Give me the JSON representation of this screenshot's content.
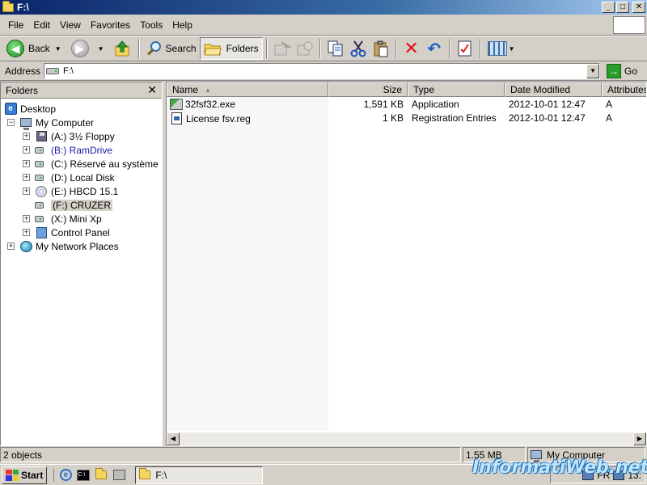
{
  "window": {
    "title": "F:\\",
    "buttons": {
      "minimize": "_",
      "maximize": "□",
      "close": "✕"
    }
  },
  "menu": [
    "File",
    "Edit",
    "View",
    "Favorites",
    "Tools",
    "Help"
  ],
  "toolbar": {
    "back_label": "Back",
    "search_label": "Search",
    "folders_label": "Folders"
  },
  "address": {
    "label": "Address",
    "value": "F:\\",
    "go_label": "Go"
  },
  "folders_pane": {
    "title": "Folders",
    "close": "✕",
    "tree": [
      {
        "label": "Desktop",
        "icon": "desktop-icon"
      },
      {
        "label": "My Computer",
        "icon": "my-computer-icon",
        "expander": "−"
      },
      {
        "label": "(A:) 3½ Floppy",
        "icon": "floppy-drive-icon",
        "expander": "+"
      },
      {
        "label": "(B:) RamDrive",
        "icon": "hard-drive-icon",
        "expander": "+"
      },
      {
        "label": "(C:) Réservé au système",
        "icon": "hard-drive-icon",
        "expander": "+"
      },
      {
        "label": "(D:) Local Disk",
        "icon": "hard-drive-icon",
        "expander": "+"
      },
      {
        "label": "(E:) HBCD 15.1",
        "icon": "cd-drive-icon",
        "expander": "+"
      },
      {
        "label": "(F:) CRUZER",
        "icon": "removable-drive-icon"
      },
      {
        "label": "(X:) Mini Xp",
        "icon": "hard-drive-icon",
        "expander": "+"
      },
      {
        "label": "Control Panel",
        "icon": "control-panel-icon",
        "expander": "+"
      },
      {
        "label": "My Network Places",
        "icon": "network-places-icon",
        "expander": "+"
      }
    ]
  },
  "file_list": {
    "columns": [
      "Name",
      "Size",
      "Type",
      "Date Modified",
      "Attributes"
    ],
    "files": [
      {
        "name": "32fsf32.exe",
        "size": "1,591 KB",
        "type": "Application",
        "date": "2012-10-01 12:47",
        "attr": "A",
        "icon": "exe-icon"
      },
      {
        "name": "License fsv.reg",
        "size": "1 KB",
        "type": "Registration Entries",
        "date": "2012-10-01 12:47",
        "attr": "A",
        "icon": "reg-file-icon"
      }
    ]
  },
  "status": {
    "objects": "2 objects",
    "size": "1.55 MB",
    "location": "My Computer"
  },
  "taskbar": {
    "start_label": "Start",
    "task_label": "F:\\",
    "tray_lang": "FR",
    "clock": "13:"
  },
  "watermark": "InformatiWeb.net",
  "colors": {
    "title_start": "#0a246a",
    "title_end": "#a6caf0",
    "face": "#d4d0c8",
    "highlight_text": "#1a1aa6"
  }
}
